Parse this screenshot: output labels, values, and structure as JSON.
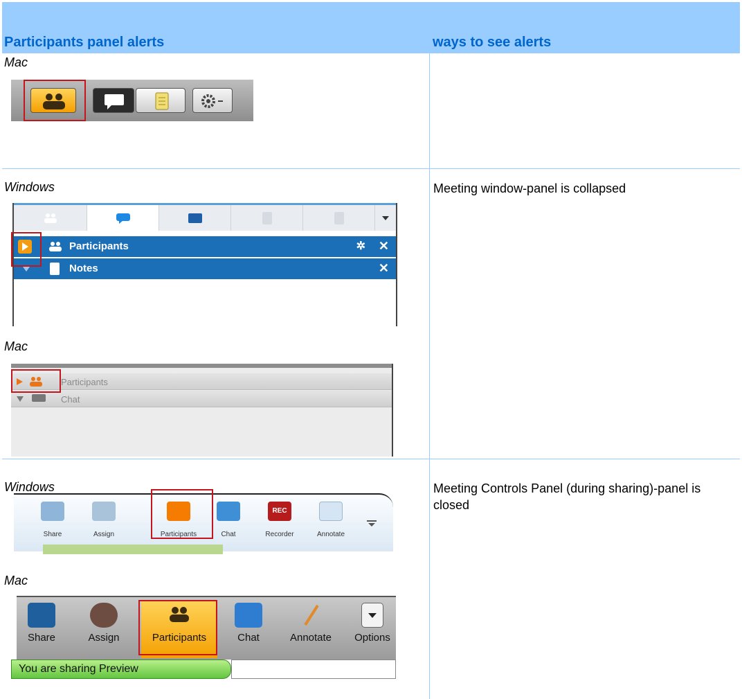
{
  "header": {
    "col_left": "Participants panel alerts",
    "col_right": "ways to see alerts"
  },
  "rows": [
    {
      "platforms": [
        "Mac"
      ],
      "description": ""
    },
    {
      "platforms": [
        "Windows",
        "Mac"
      ],
      "description": "Meeting window-panel is collapsed"
    },
    {
      "platforms": [
        "Windows",
        "Mac"
      ],
      "description": "Meeting Controls Panel (during sharing)-panel is closed"
    }
  ],
  "win_panel": {
    "participants_label": "Participants",
    "notes_label": "Notes",
    "close_glyph": "✕"
  },
  "mac_panel": {
    "participants_label": "Participants",
    "chat_label": "Chat"
  },
  "win_toolbar": {
    "buttons": [
      "Share",
      "Assign",
      "Participants",
      "Chat",
      "Recorder",
      "Annotate"
    ],
    "rec_badge": "REC"
  },
  "mac_toolbar": {
    "buttons": [
      "Share",
      "Assign",
      "Participants",
      "Chat",
      "Annotate",
      "Options"
    ],
    "sharing_status": "You are sharing Preview"
  },
  "colors": {
    "header_bg": "#99ccff",
    "header_text": "#0066cc",
    "highlight_box": "#c4151c",
    "windows_blue": "#1b6fb7",
    "alert_orange": "#f39c12"
  }
}
